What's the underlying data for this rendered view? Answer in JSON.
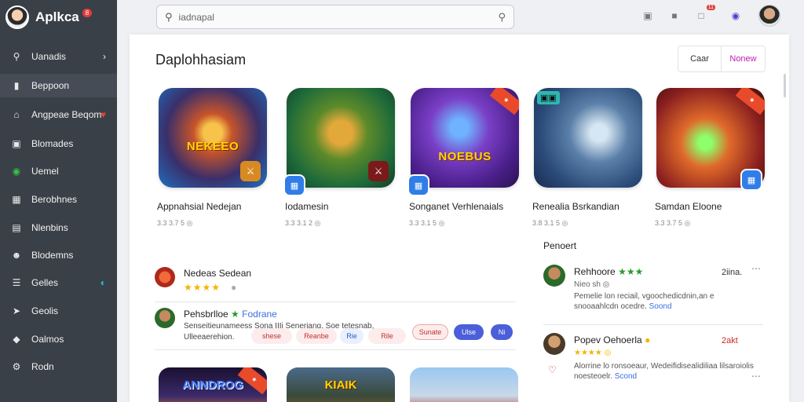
{
  "app": {
    "name": "Aplkca",
    "badge": "8"
  },
  "sidebar": {
    "items": [
      {
        "label": "Uanadis",
        "icon": "search-icon",
        "trail": "›"
      },
      {
        "label": "Beppoon",
        "icon": "bookmark-icon",
        "trail": ""
      },
      {
        "label": "Angpeae Beqom",
        "icon": "home-icon",
        "trail": "♥"
      },
      {
        "label": "Blomades",
        "icon": "folder-icon",
        "trail": ""
      },
      {
        "label": "Uemel",
        "icon": "circle-icon",
        "trail": ""
      },
      {
        "label": "Berobhnes",
        "icon": "grid-icon",
        "trail": ""
      },
      {
        "label": "Nlenbins",
        "icon": "list-icon",
        "trail": ""
      },
      {
        "label": "Blodemns",
        "icon": "people-icon",
        "trail": ""
      },
      {
        "label": "Gelles",
        "icon": "chart-icon",
        "trail": "◐"
      },
      {
        "label": "Geolis",
        "icon": "send-icon",
        "trail": ""
      },
      {
        "label": "Oalmos",
        "icon": "tag-icon",
        "trail": ""
      },
      {
        "label": "Rodn",
        "icon": "settings-icon",
        "trail": ""
      }
    ]
  },
  "search": {
    "placeholder": "iadnapal"
  },
  "header": {
    "notif_badge": "11"
  },
  "main": {
    "title": "Daplohhasiam",
    "tabs": [
      {
        "label": "Caar"
      },
      {
        "label": "Nonew"
      }
    ]
  },
  "apps": [
    {
      "title": "Appnahsial Nedejan",
      "meta": "3.3  3.7 5  ◎",
      "caption": "NEKEEO"
    },
    {
      "title": "Iodamesin",
      "meta": "3.3  3.1 2  ◎",
      "caption": ""
    },
    {
      "title": "Songanet Verhlenaials",
      "meta": "3.3  3.1 5  ◎",
      "caption": "NOEBUS"
    },
    {
      "title": "Renealia Bsrkandian",
      "meta": "3.8  3.1 5  ◎",
      "caption": ""
    },
    {
      "title": "Samdan Eloone",
      "meta": "3.3  3.7 5  ◎",
      "caption": ""
    }
  ],
  "reviews": [
    {
      "name": "Nedeas Sedean",
      "stars": "★★★★",
      "extra": "●"
    },
    {
      "name": "Pehsbrlloe",
      "tag": "Fodrane",
      "text1": "Senseitieunameess Sona  IIIi Seneriang,  Soe tetesnab,",
      "text2": "Ulleeaerehion.",
      "chips": [
        "shese",
        "Reanbe",
        "Rie",
        "Rile",
        "Sunate",
        "Ulse",
        "Ni"
      ]
    }
  ],
  "recent": {
    "label": "Penoert",
    "items": [
      {
        "name": "Rehhoore",
        "stars": "★★★",
        "time": "2iina.",
        "sub": "Nieo sh ◎",
        "text": "Pemelie lon reciail, vgoochedicdnin,an e snooaahlcdn ocedre.",
        "link": "Soond"
      },
      {
        "name": "Popev Oehoerla",
        "stars": "★★★★",
        "time": "2akt",
        "sub": "★★★★ ◎",
        "text": "Alorrine lo ronsoeaur, Wedeifidisealidiliaa lilsaroiolis noesteoelr.",
        "link": "Scond"
      }
    ]
  },
  "bottom": [
    {
      "caption": "ANNDROG"
    },
    {
      "caption": "KIAIK"
    },
    {
      "caption": ""
    }
  ],
  "colors": {
    "sidebar": "#3a4048",
    "accent": "#c21ab4",
    "star": "#f4b400",
    "link": "#3b6fe0"
  }
}
